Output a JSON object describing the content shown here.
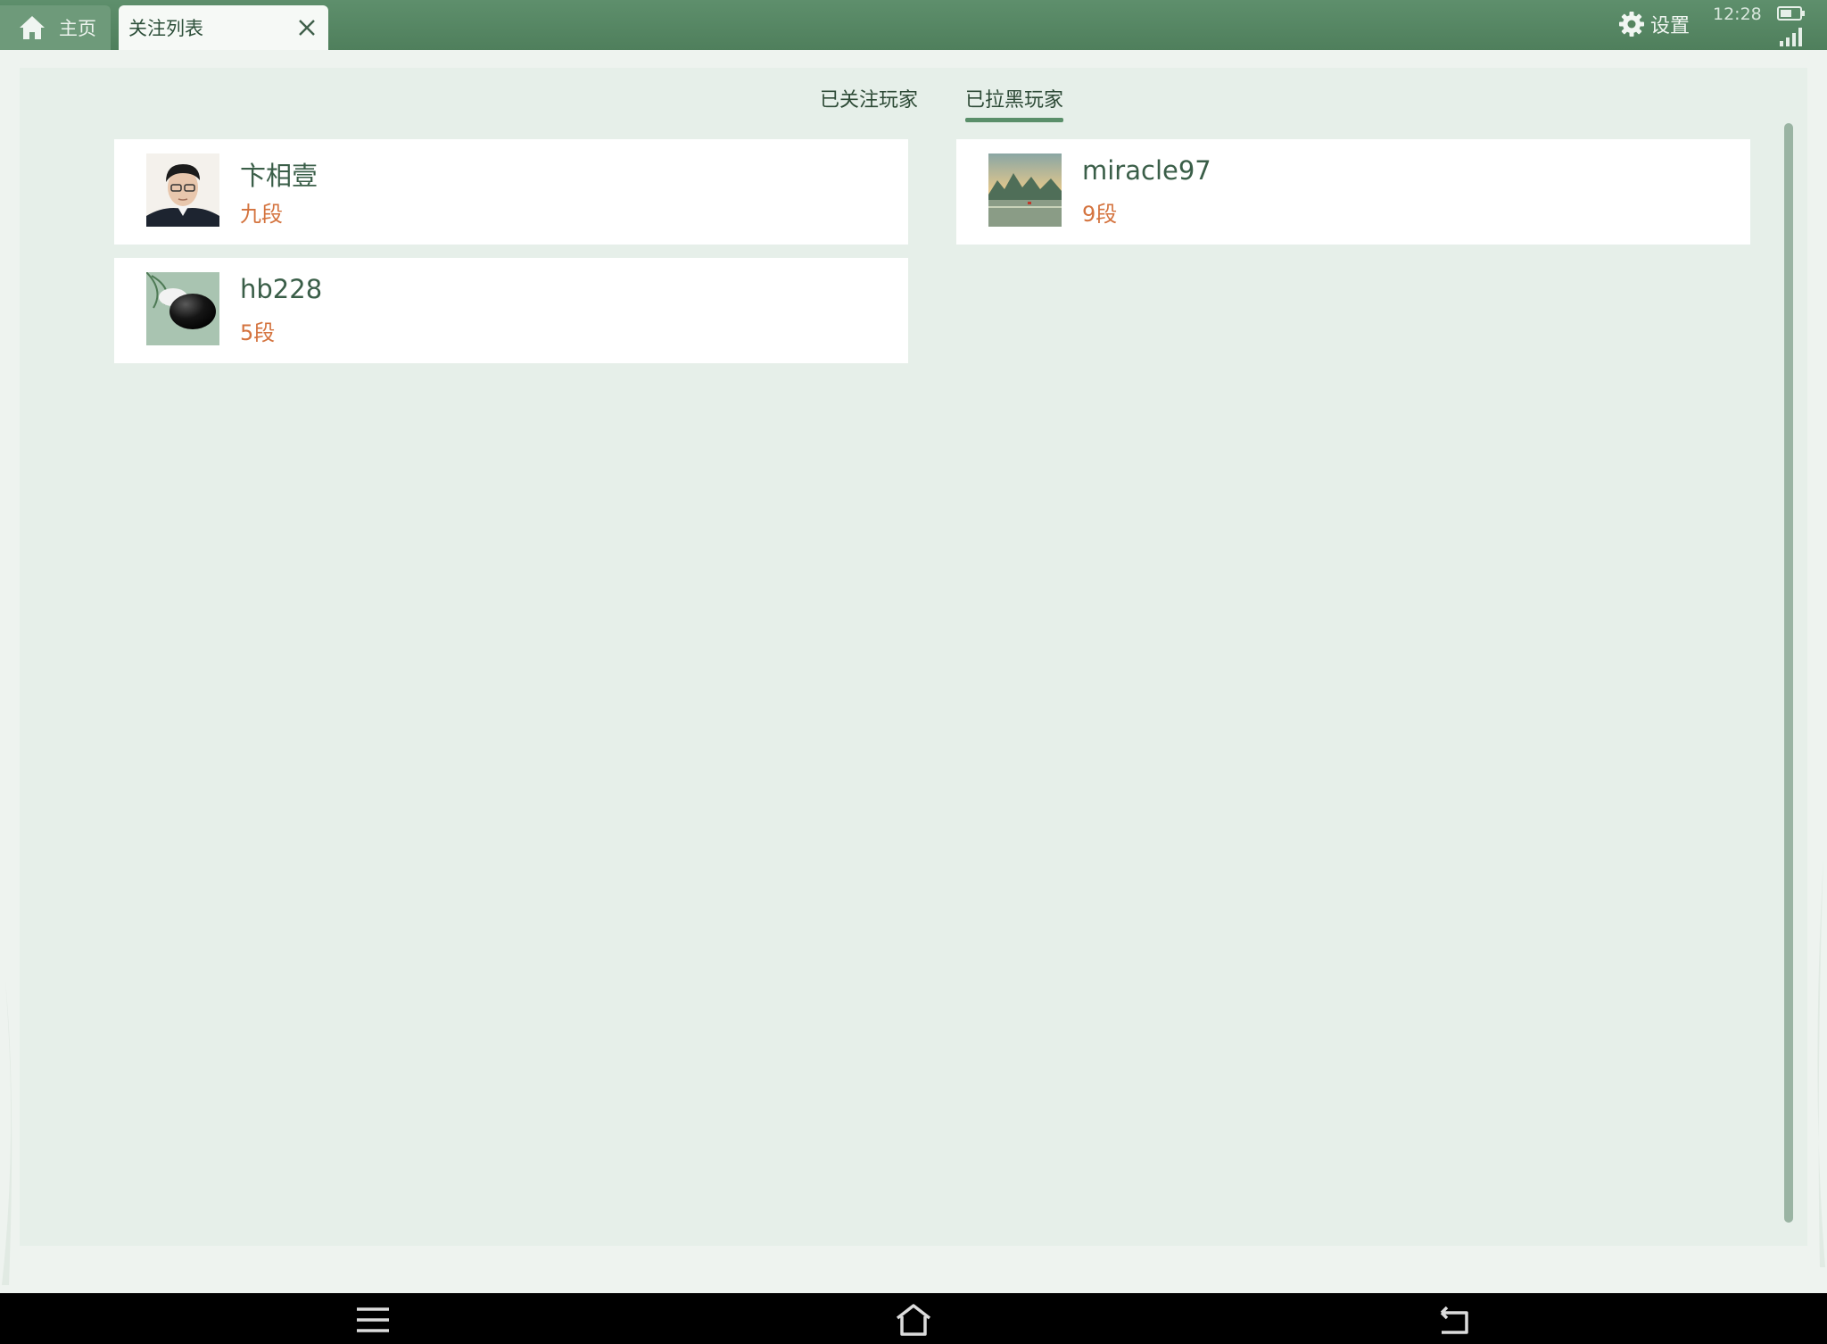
{
  "tabs": {
    "home_label": "主页",
    "active_label": "关注列表"
  },
  "status": {
    "settings_label": "设置",
    "time": "12:28"
  },
  "segments": {
    "followed_label": "已关注玩家",
    "blocked_label": "已拉黑玩家",
    "selected": "blocked"
  },
  "players": [
    {
      "name": "卞相壹",
      "rank": "九段",
      "avatar": "man-portrait"
    },
    {
      "name": "miracle97",
      "rank": "9段",
      "avatar": "landscape-photo"
    },
    {
      "name": "hb228",
      "rank": "5段",
      "avatar": "go-stone"
    }
  ],
  "colors": {
    "topbar": "#54845f",
    "accent": "#5a8f6a",
    "rank": "#d4733e",
    "panel": "#e6efe9"
  },
  "icons": {
    "home": "home-icon",
    "close": "close-icon",
    "settings": "gear-icon",
    "battery": "battery-icon",
    "signal": "signal-icon",
    "nav_menu": "menu-icon",
    "nav_home": "home-outline-icon",
    "nav_back": "back-icon"
  }
}
